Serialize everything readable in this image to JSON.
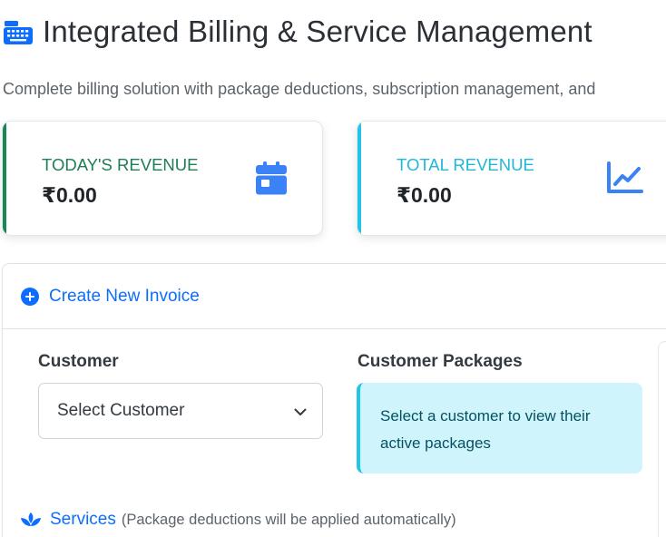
{
  "header": {
    "title": "Integrated Billing & Service Management",
    "subtitle": "Complete billing solution with package deductions, subscription management, and",
    "icon": "cash-register-icon"
  },
  "stats": [
    {
      "label": "TODAY'S REVENUE",
      "value": "₹0.00",
      "icon": "calendar-icon",
      "accent": "#198754"
    },
    {
      "label": "TOTAL REVENUE",
      "value": "₹0.00",
      "icon": "chart-line-icon",
      "accent": "#22c5e6"
    }
  ],
  "invoice": {
    "title": "Create New Invoice",
    "icon": "plus-circle-icon",
    "customer_label": "Customer",
    "customer_select_value": "Select Customer",
    "packages_label": "Customer Packages",
    "packages_info": "Select a customer to view their active packages",
    "services_title": "Services",
    "services_note": "(Package deductions will be applied automatically)",
    "services_icon": "spa-icon"
  },
  "colors": {
    "primary": "#0d6efd",
    "success": "#198754",
    "info": "#22c5e6",
    "info_bg": "#cff4fc"
  }
}
